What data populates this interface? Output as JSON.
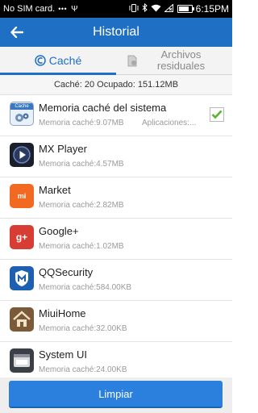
{
  "status_bar": {
    "carrier": "No SIM card.",
    "dots": "•••",
    "usb": "Ψ",
    "time": "6:15PM",
    "battery_level": 0.8
  },
  "header": {
    "title": "Historial"
  },
  "tabs": [
    {
      "label": "Caché",
      "icon": "broom-icon",
      "active": true
    },
    {
      "label": "Archivos residuales",
      "icon": "file-icon",
      "active": false
    }
  ],
  "summary": "Caché: 20 Ocupado: 151.12MB",
  "items": [
    {
      "name": "Memoria caché del sistema",
      "size": "Memoria caché:9.07MB",
      "extra": "Aplicaciones:...",
      "icon": "cache-gear-icon",
      "checked": true
    },
    {
      "name": "MX Player",
      "size": "Memoria caché:4.57MB",
      "icon": "mx-player-icon"
    },
    {
      "name": "Market",
      "size": "Memoria caché:2.82MB",
      "icon": "mi-market-icon",
      "icon_text": "mi"
    },
    {
      "name": "Google+",
      "size": "Memoria caché:1.02MB",
      "icon": "google-plus-icon",
      "icon_text": "g+"
    },
    {
      "name": "QQSecurity",
      "size": "Memoria caché:584.00KB",
      "icon": "shield-icon"
    },
    {
      "name": "MiuiHome",
      "size": "Memoria caché:32.00KB",
      "icon": "home-icon"
    },
    {
      "name": "System UI",
      "size": "Memoria caché:24.00KB",
      "icon": "system-ui-icon"
    }
  ],
  "cache_icon_label": "Cache",
  "button": {
    "label": "Limpiar"
  },
  "colors": {
    "primary": "#1f6fc4",
    "button": "#2a80dc",
    "check": "#58b52a"
  }
}
